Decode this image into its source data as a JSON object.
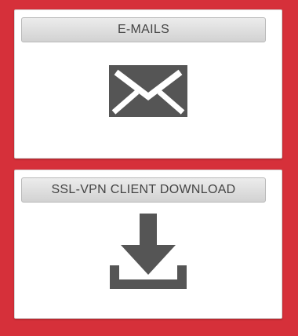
{
  "cards": [
    {
      "label": "E-MAILS",
      "icon": "envelope-icon"
    },
    {
      "label": "SSL-VPN CLIENT DOWNLOAD",
      "icon": "download-icon"
    }
  ],
  "colors": {
    "background": "#d6303a",
    "card": "#ffffff",
    "icon": "#555555",
    "tab_text": "#444444"
  }
}
